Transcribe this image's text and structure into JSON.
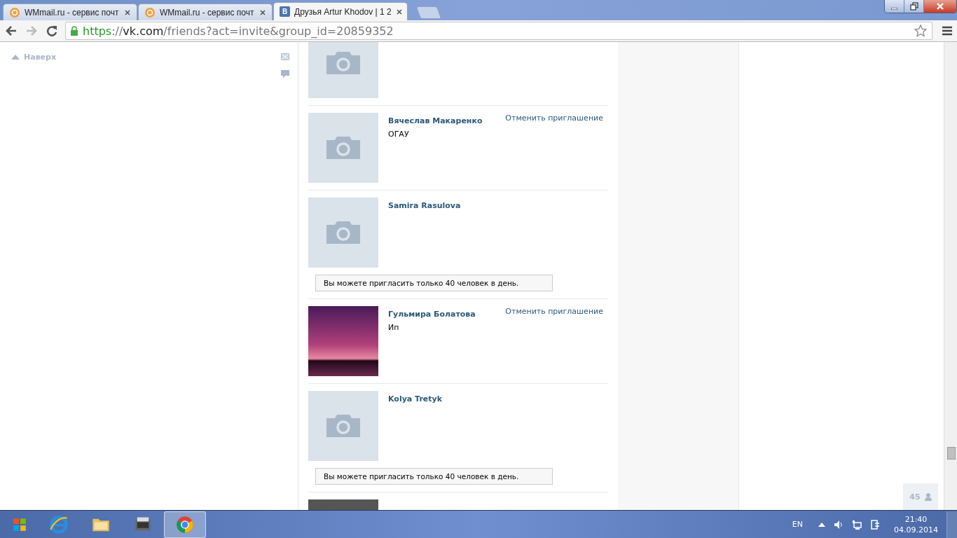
{
  "browser": {
    "tabs": [
      {
        "title": "WMmail.ru - сервис почт",
        "kind": "mail",
        "selected": false
      },
      {
        "title": "WMmail.ru - сервис почт",
        "kind": "mail",
        "selected": false
      },
      {
        "title": "Друзья Artur Khodov | 1 2",
        "kind": "site",
        "selected": true
      }
    ],
    "favicon_letter": "В",
    "url": [
      {
        "text": "https",
        "kind": "secure"
      },
      {
        "text": "://",
        "kind": "plain"
      },
      {
        "text": "vk.com",
        "kind": "host"
      },
      {
        "text": "/friends?act=invite&group_id=20859352",
        "kind": "plain"
      }
    ]
  },
  "left": {
    "back_to_top": "Наверх"
  },
  "items": [
    {
      "kind": "placeholder"
    },
    {
      "kind": "placeholder",
      "name": "Вячеслав Макаренко",
      "subtitle": "ОГАУ",
      "action": "Отменить приглашение"
    },
    {
      "kind": "placeholder",
      "name": "Samira Rasulova",
      "notice": "Вы можете пригласить только 40 человек в день."
    },
    {
      "kind": "image",
      "name": "Гульмира Болатова",
      "subtitle": "Ип",
      "action": "Отменить приглашение"
    },
    {
      "kind": "placeholder",
      "name": "Kolya Tretyk",
      "notice": "Вы можете пригласить только 40 человек в день."
    },
    {
      "kind": "dark"
    }
  ],
  "online_count": "45",
  "taskbar": {
    "apps": [
      {
        "kind": "ie",
        "selected": false
      },
      {
        "kind": "folder",
        "selected": false
      },
      {
        "kind": "app",
        "selected": false
      },
      {
        "kind": "chrome",
        "selected": true
      }
    ],
    "language": "EN",
    "time": "21:40",
    "date": "04.09.2014"
  }
}
